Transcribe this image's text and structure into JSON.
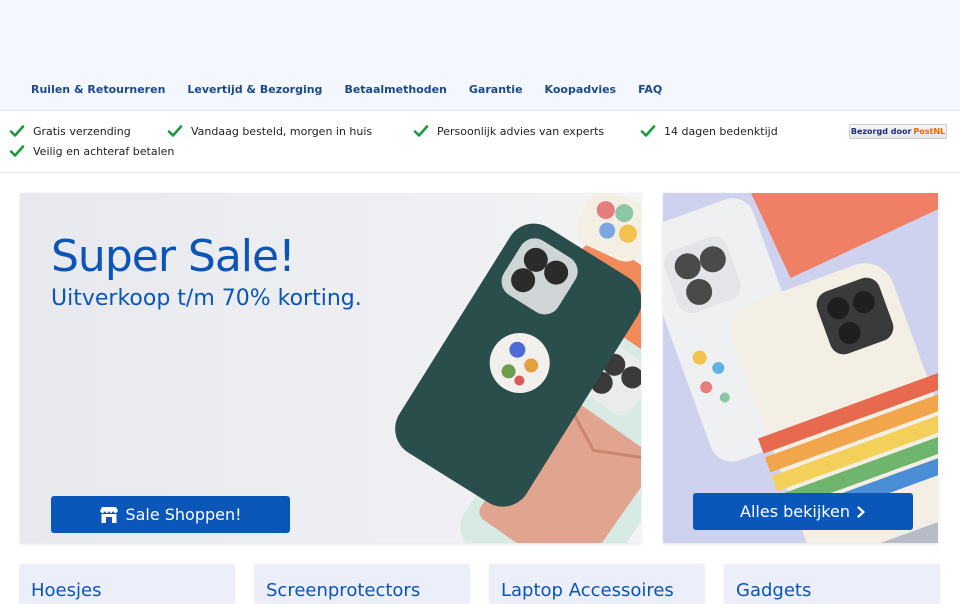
{
  "nav": {
    "items": [
      "Ruilen & Retourneren",
      "Levertijd & Bezorging",
      "Betaalmethoden",
      "Garantie",
      "Koopadvies",
      "FAQ"
    ]
  },
  "usps": [
    "Gratis verzending",
    "Vandaag besteld, morgen in huis",
    "Persoonlijk advies van experts",
    "14 dagen bedenktijd",
    "Veilig en achteraf betalen"
  ],
  "postnl": {
    "prefix": "Bezorgd door",
    "brand": "PostNL"
  },
  "hero": {
    "title": "Super Sale!",
    "subtitle": "Uitverkoop t/m 70% korting.",
    "button_label": "Sale Shoppen!",
    "button_icon": "store-icon"
  },
  "side_banner": {
    "button_label": "Alles bekijken",
    "button_icon": "chevron-right-icon"
  },
  "categories": [
    "Hoesjes",
    "Screenprotectors",
    "Laptop Accessoires",
    "Gadgets"
  ],
  "colors": {
    "brand_blue": "#0a56b9",
    "check_green": "#1e9a3c",
    "nav_blue": "#1a4a8a",
    "postnl_orange": "#ff6200"
  }
}
